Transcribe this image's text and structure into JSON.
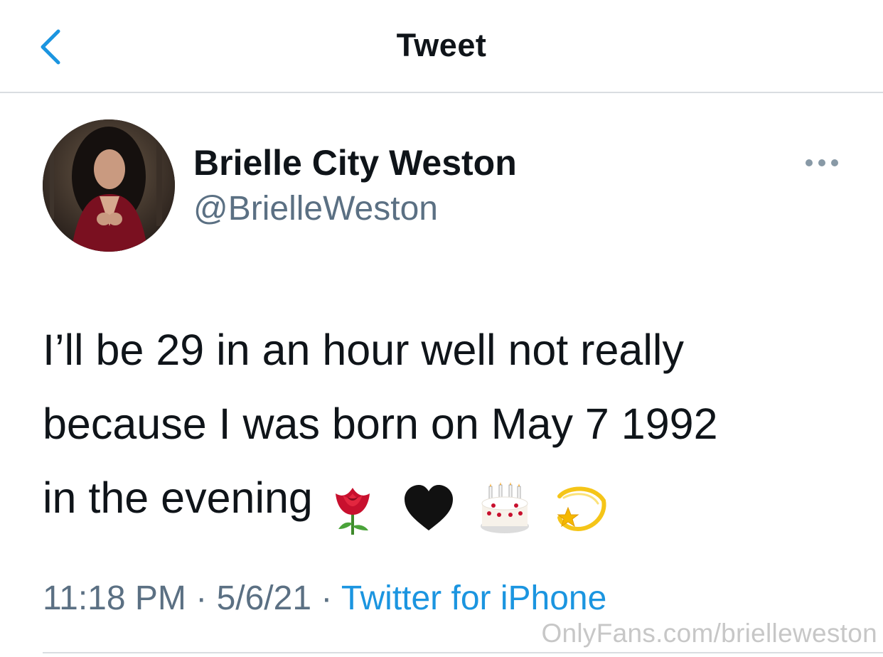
{
  "header": {
    "title": "Tweet",
    "back_icon": "chevron-left-icon"
  },
  "colors": {
    "accent": "#1b95e0",
    "secondary_text": "#5b7083",
    "primary_text": "#0f1419",
    "divider": "#d9dde1",
    "watermark": "#c7c7c7"
  },
  "tweet": {
    "author": {
      "name": "Brielle City Weston",
      "handle": "@BrielleWeston"
    },
    "more_icon": "ellipsis-icon",
    "text_lines": [
      "I’ll be 29 in an hour well not really",
      "because I was born on May 7 1992",
      "in the evening"
    ],
    "emojis": [
      "rose-emoji",
      "black-heart-emoji",
      "birthday-cake-emoji",
      "dizzy-star-emoji"
    ],
    "time": "11:18 PM",
    "date": "5/6/21",
    "separator": "·",
    "source": "Twitter for iPhone"
  },
  "watermark": "OnlyFans.com/brielleweston"
}
